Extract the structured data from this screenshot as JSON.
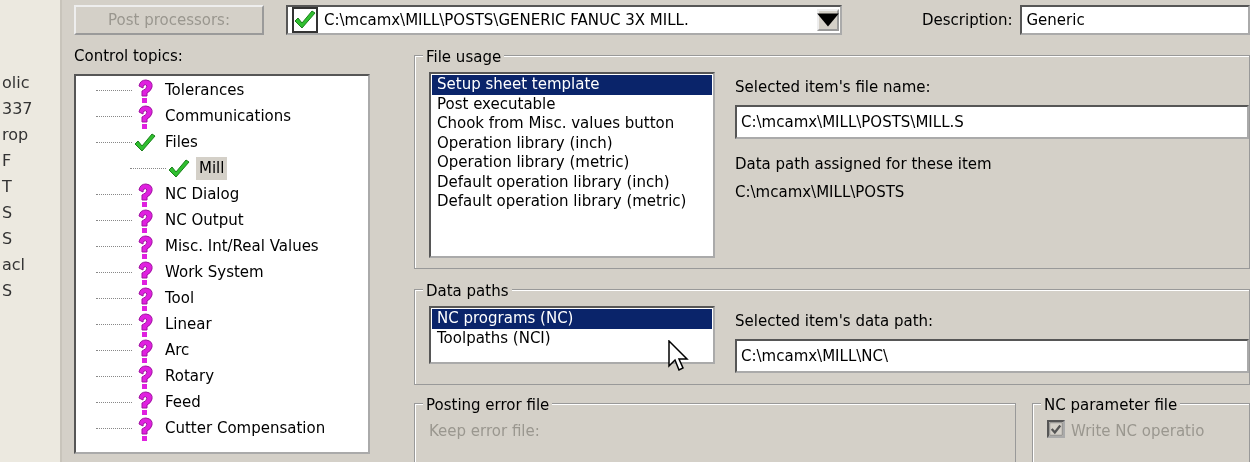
{
  "side_strip": {
    "texts": [
      "olic",
      "337",
      "rop",
      "F",
      "T",
      "S",
      "S",
      "acl",
      "S"
    ]
  },
  "toolbar": {
    "post_button": {
      "label": "Post processors:",
      "disabled": true
    },
    "post_combo": {
      "value": "C:\\mcamx\\MILL\\POSTS\\GENERIC FANUC 3X MILL.",
      "checked": true
    },
    "description_label": "Description:",
    "description_value": "Generic"
  },
  "control_topics": {
    "label": "Control topics:",
    "items": [
      {
        "label": "Tolerances",
        "complete": false,
        "selected": false
      },
      {
        "label": "Communications",
        "complete": false,
        "selected": false
      },
      {
        "label": "Files",
        "complete": true,
        "selected": false,
        "children": [
          {
            "label": "Mill",
            "complete": true,
            "selected": true
          }
        ]
      },
      {
        "label": "NC Dialog",
        "complete": false,
        "selected": false
      },
      {
        "label": "NC Output",
        "complete": false,
        "selected": false
      },
      {
        "label": "Misc. Int/Real Values",
        "complete": false,
        "selected": false
      },
      {
        "label": "Work System",
        "complete": false,
        "selected": false
      },
      {
        "label": "Tool",
        "complete": false,
        "selected": false
      },
      {
        "label": "Linear",
        "complete": false,
        "selected": false
      },
      {
        "label": "Arc",
        "complete": false,
        "selected": false
      },
      {
        "label": "Rotary",
        "complete": false,
        "selected": false
      },
      {
        "label": "Feed",
        "complete": false,
        "selected": false
      },
      {
        "label": "Cutter Compensation",
        "complete": false,
        "selected": false
      }
    ]
  },
  "file_usage": {
    "title": "File usage",
    "items": [
      {
        "label": "Setup sheet template",
        "selected": true
      },
      {
        "label": "Post executable",
        "selected": false
      },
      {
        "label": "Chook from Misc. values button",
        "selected": false
      },
      {
        "label": "Operation library (inch)",
        "selected": false
      },
      {
        "label": "Operation library (metric)",
        "selected": false
      },
      {
        "label": "Default operation library (inch)",
        "selected": false
      },
      {
        "label": "Default operation library (metric)",
        "selected": false
      }
    ],
    "file_name_label": "Selected item's file name:",
    "file_name_value": "C:\\mcamx\\MILL\\POSTS\\MILL.S",
    "data_path_label": "Data path assigned for these item",
    "data_path_value": "C:\\mcamx\\MILL\\POSTS"
  },
  "data_paths": {
    "title": "Data paths",
    "items": [
      {
        "label": "NC programs (NC)",
        "selected": true
      },
      {
        "label": "Toolpaths (NCI)",
        "selected": false
      }
    ],
    "path_label": "Selected item's data path:",
    "path_value": "C:\\mcamx\\MILL\\NC\\"
  },
  "posting_error_file": {
    "title": "Posting error file",
    "keep_label": "Keep error file:"
  },
  "nc_parameter_file": {
    "title": "NC parameter file",
    "write_label": "Write NC operatio",
    "checked": true,
    "disabled": true
  }
}
